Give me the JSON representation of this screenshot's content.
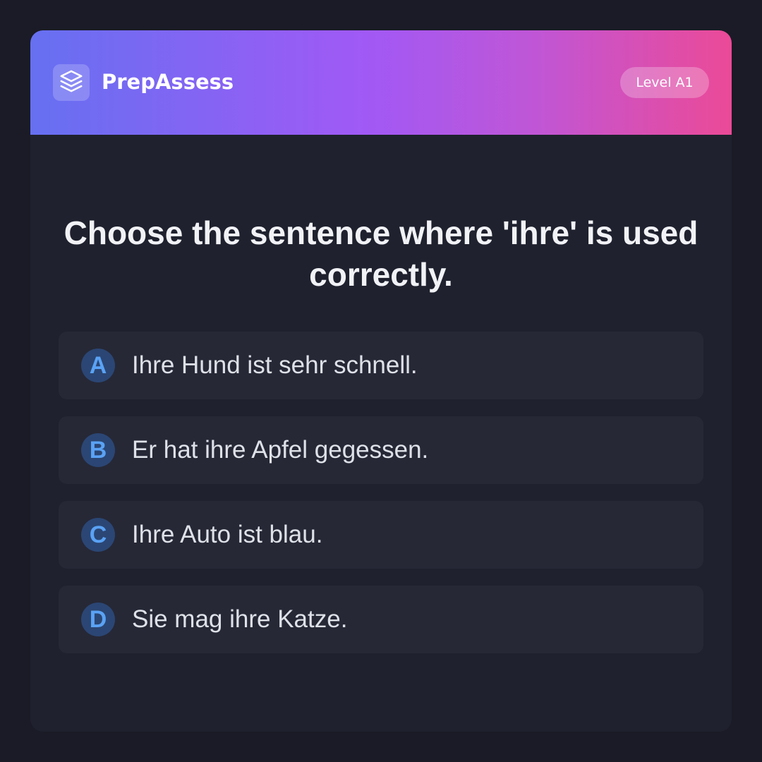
{
  "header": {
    "logo_icon": "stack-layers-icon",
    "brand": "PrepAssess",
    "level_badge": "Level A1",
    "gradient_colors": [
      "#6670f1",
      "#a159f5",
      "#eb4a97"
    ]
  },
  "question": {
    "text": "Choose the sentence where 'ihre' is used correctly."
  },
  "options": [
    {
      "letter": "A",
      "text": "Ihre Hund ist sehr schnell."
    },
    {
      "letter": "B",
      "text": "Er hat ihre Apfel gegessen."
    },
    {
      "letter": "C",
      "text": "Ihre Auto ist blau."
    },
    {
      "letter": "D",
      "text": "Sie mag ihre Katze."
    }
  ],
  "colors": {
    "background": "#1a1b26",
    "card": "#1f212e",
    "option_bg": "#262836",
    "accent_letter": "#5aa2f5"
  }
}
